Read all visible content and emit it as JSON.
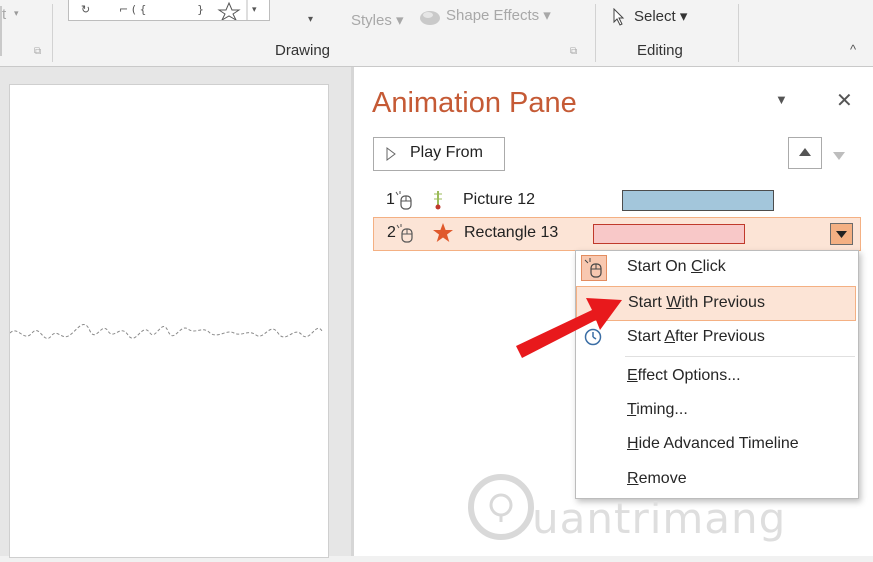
{
  "ribbon": {
    "group_drawing": "Drawing",
    "group_editing": "Editing",
    "styles_label": "Styles",
    "shape_effects_label": "Shape Effects",
    "select_label": "Select",
    "partial_left": "t"
  },
  "pane": {
    "title": "Animation Pane",
    "play_from_label": "Play From",
    "items": [
      {
        "num": "1",
        "label": "Picture 12",
        "bar_color": "#a3c6db",
        "bar_border": "#4c4c4c"
      },
      {
        "num": "2",
        "label": "Rectangle 13",
        "bar_color": "#f8c8c8",
        "bar_border": "#c0392b"
      }
    ]
  },
  "context_menu": {
    "items": [
      {
        "pre": "Start On ",
        "ul": "C",
        "post": "lick"
      },
      {
        "pre": "Start ",
        "ul": "W",
        "post": "ith Previous"
      },
      {
        "pre": "Start ",
        "ul": "A",
        "post": "fter Previous"
      },
      {
        "pre": "",
        "ul": "E",
        "post": "ffect Options..."
      },
      {
        "pre": "",
        "ul": "T",
        "post": "iming..."
      },
      {
        "pre": "",
        "ul": "H",
        "post": "ide Advanced Timeline"
      },
      {
        "pre": "",
        "ul": "R",
        "post": "emove"
      }
    ],
    "highlighted_index": 1
  },
  "watermark": {
    "text": "uantrimang"
  },
  "colors": {
    "accent": "#c55a35",
    "highlight_bg": "#fce4d6",
    "arrow": "#e8191c"
  }
}
